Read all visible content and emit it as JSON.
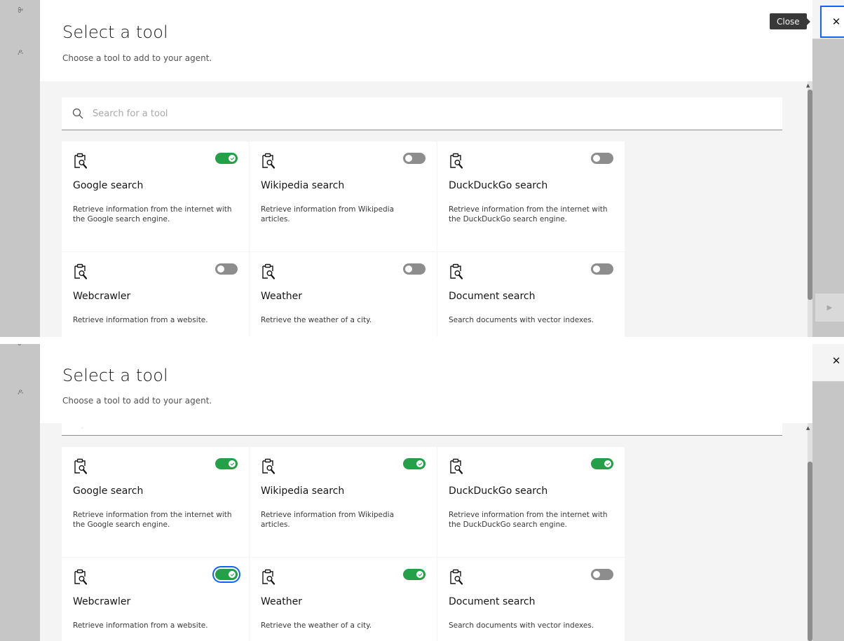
{
  "modal": {
    "title": "Select a tool",
    "subtitle": "Choose a tool to add to your agent.",
    "close_tooltip": "Close",
    "close_symbol": "✕"
  },
  "search": {
    "placeholder": "Search for a tool",
    "icon": "search-icon"
  },
  "background": {
    "left_glyph_top": "ꔬ",
    "left_glyph_user": "ዶ",
    "send_symbol": "▶"
  },
  "colors": {
    "toggle_on": "#24a148",
    "toggle_off": "#8d8d8d",
    "focus": "#0f62fe"
  },
  "frame1": {
    "tools": [
      {
        "name": "Google search",
        "description": "Retrieve information from the internet with the Google search engine.",
        "enabled": true
      },
      {
        "name": "Wikipedia search",
        "description": "Retrieve information from Wikipedia articles.",
        "enabled": false
      },
      {
        "name": "DuckDuckGo search",
        "description": "Retrieve information from the internet with the DuckDuckGo search engine.",
        "enabled": false
      },
      {
        "name": "Webcrawler",
        "description": "Retrieve information from a website.",
        "enabled": false
      },
      {
        "name": "Weather",
        "description": "Retrieve the weather of a city.",
        "enabled": false
      },
      {
        "name": "Document search",
        "description": "Search documents with vector indexes.",
        "enabled": false
      }
    ]
  },
  "frame2": {
    "tools": [
      {
        "name": "Google search",
        "description": "Retrieve information from the internet with the Google search engine.",
        "enabled": true
      },
      {
        "name": "Wikipedia search",
        "description": "Retrieve information from Wikipedia articles.",
        "enabled": true
      },
      {
        "name": "DuckDuckGo search",
        "description": "Retrieve information from the internet with the DuckDuckGo search engine.",
        "enabled": true
      },
      {
        "name": "Webcrawler",
        "description": "Retrieve information from a website.",
        "enabled": true
      },
      {
        "name": "Weather",
        "description": "Retrieve the weather of a city.",
        "enabled": true
      },
      {
        "name": "Document search",
        "description": "Search documents with vector indexes.",
        "enabled": false
      }
    ]
  }
}
